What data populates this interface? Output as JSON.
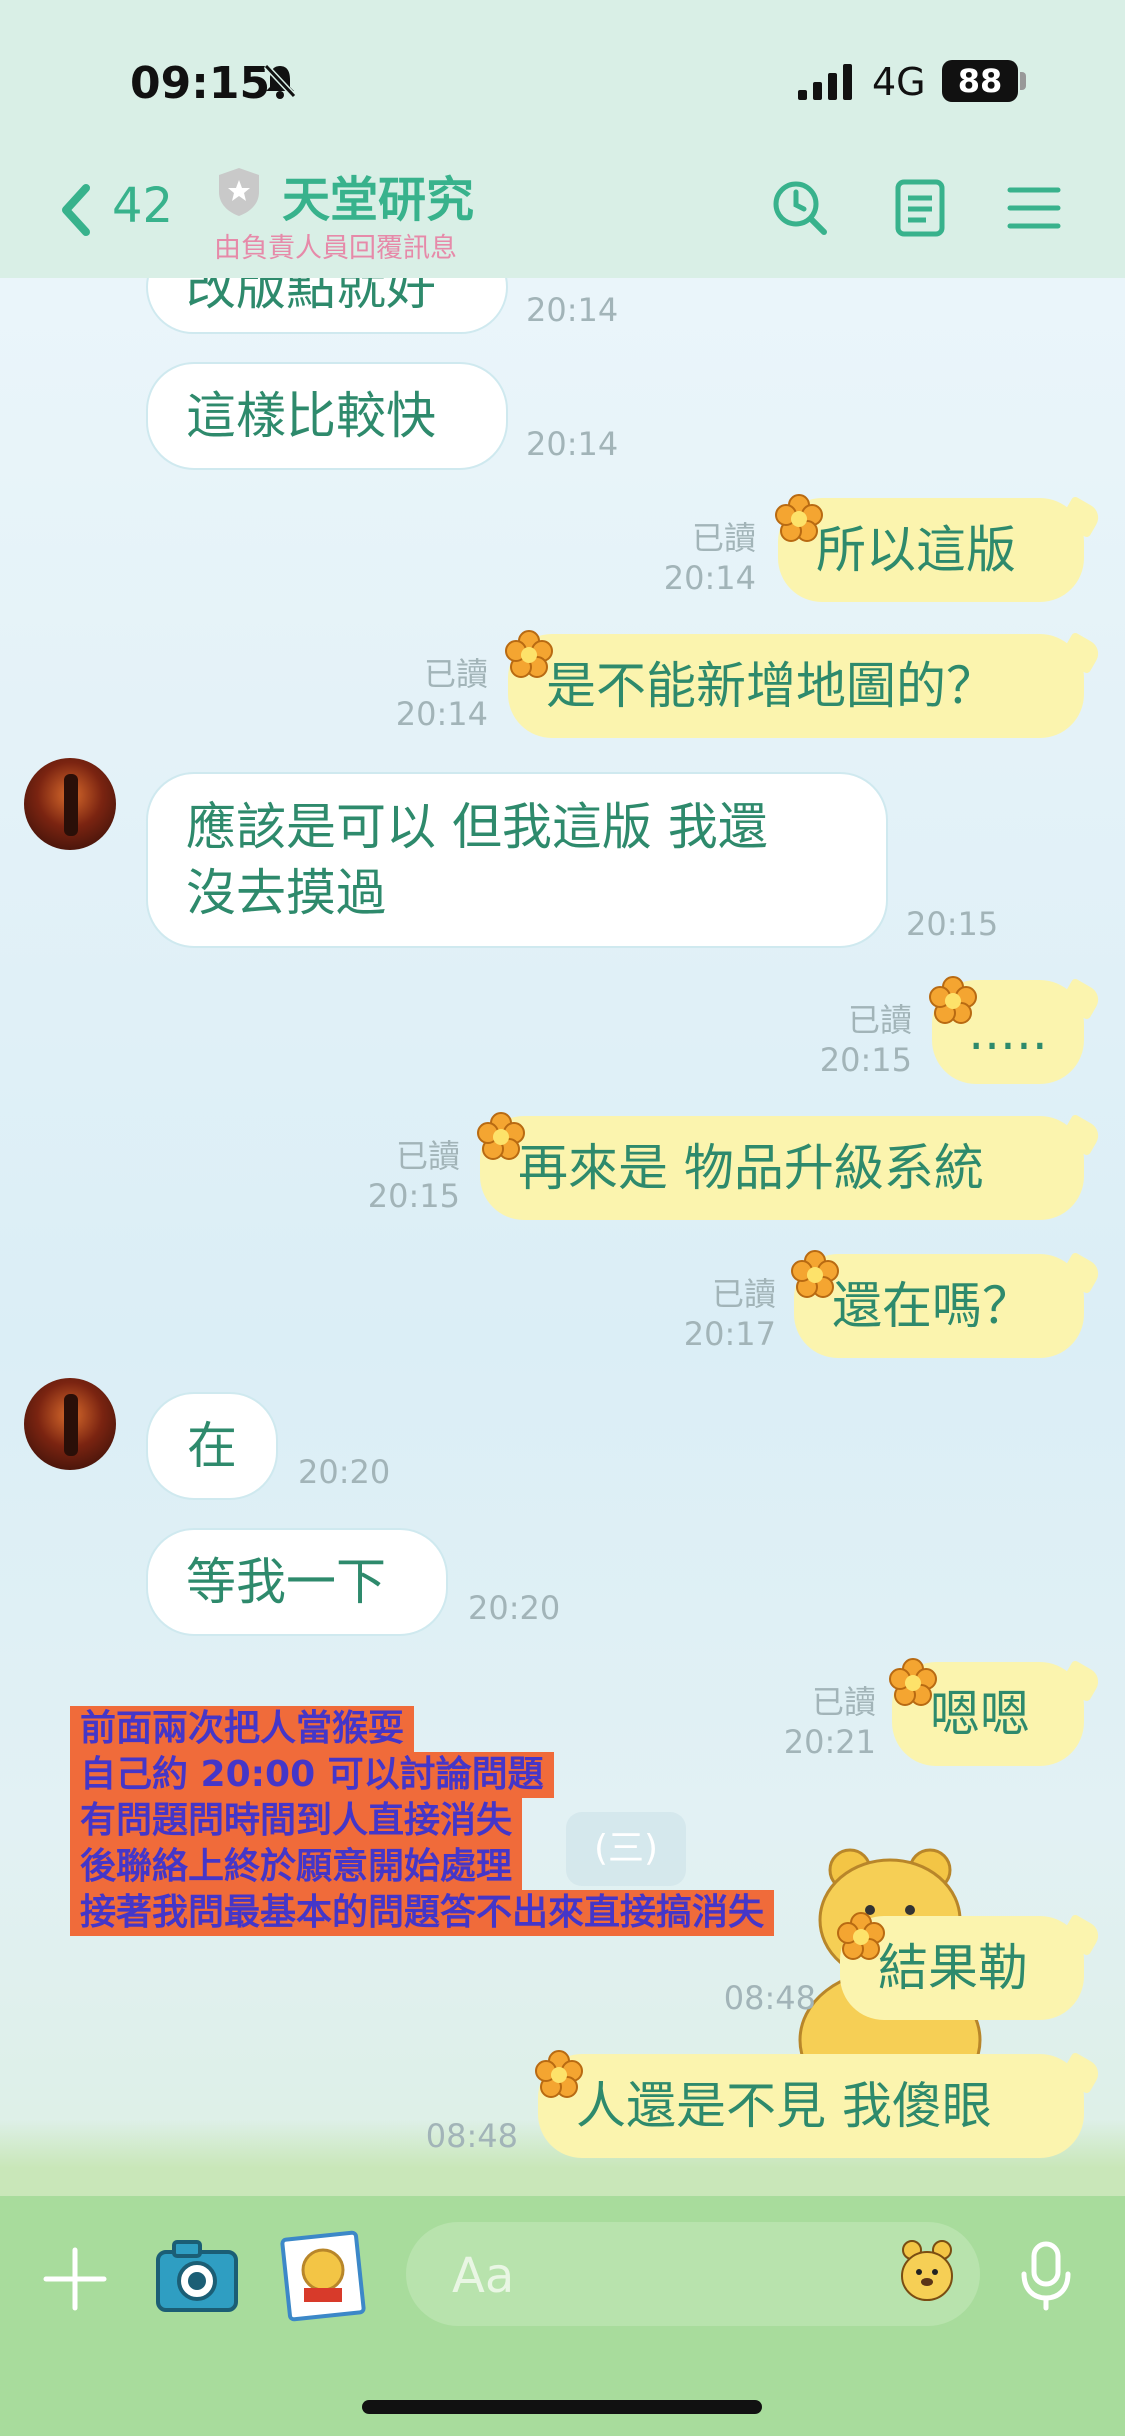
{
  "status_bar": {
    "time": "09:15",
    "network": "4G",
    "battery": "88"
  },
  "header": {
    "back_count": "42",
    "title": "天堂研究",
    "subtitle": "由負責人員回覆訊息"
  },
  "messages": [
    {
      "side": "recv",
      "text": "改版點就好",
      "time": "20:14"
    },
    {
      "side": "recv",
      "text": "這樣比較快",
      "time": "20:14"
    },
    {
      "side": "sent",
      "text": "所以這版",
      "read": "已讀",
      "time": "20:14"
    },
    {
      "side": "sent",
      "text": "是不能新增地圖的？",
      "read": "已讀",
      "time": "20:14"
    },
    {
      "side": "recv",
      "text_line1": "應該是可以  但我這版 我還",
      "text_line2": "沒去摸過",
      "time": "20:15"
    },
    {
      "side": "sent",
      "text": ".....",
      "read": "已讀",
      "time": "20:15"
    },
    {
      "side": "sent",
      "text": "再來是 物品升級系統",
      "read": "已讀",
      "time": "20:15"
    },
    {
      "side": "sent",
      "text": "還在嗎？",
      "read": "已讀",
      "time": "20:17"
    },
    {
      "side": "recv",
      "text": "在",
      "time": "20:20"
    },
    {
      "side": "recv",
      "text": "等我一下",
      "time": "20:20"
    },
    {
      "side": "sent",
      "text": "嗯嗯",
      "read": "已讀",
      "time": "20:21"
    },
    {
      "side": "sent",
      "text": "結果勒",
      "time": "08:48"
    },
    {
      "side": "sent",
      "text": "人還是不見 我傻眼",
      "time": "08:48"
    }
  ],
  "date_chip": "(三)",
  "overlay": [
    "前面兩次把人當猴耍",
    "自己約 20:00 可以討論問題",
    "有問題問時間到人直接消失",
    "後聯絡上終於願意開始處理",
    "接著我問最基本的問題答不出來直接搞消失"
  ],
  "input": {
    "placeholder": "Aa"
  },
  "colors": {
    "accent": "#38b28c",
    "sent_bubble": "#fbf4ae",
    "overlay_bg": "#f06b3a",
    "overlay_text": "#4536c8"
  }
}
